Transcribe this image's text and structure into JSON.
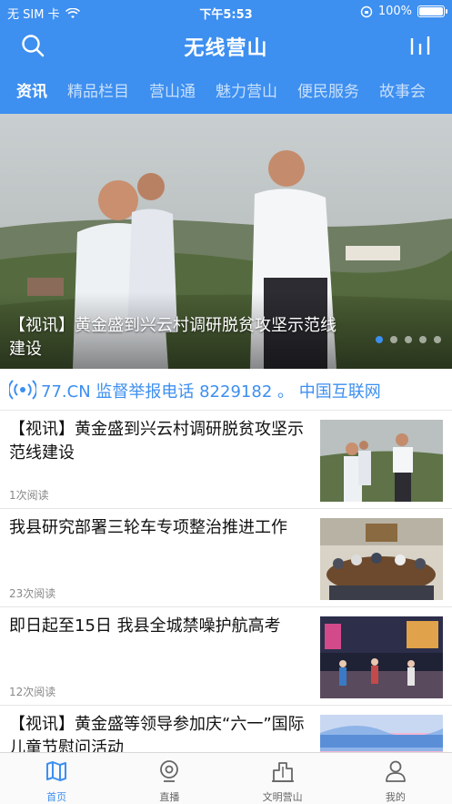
{
  "status_bar": {
    "carrier": "无 SIM 卡",
    "time": "下午5:53",
    "battery": "100%"
  },
  "header": {
    "title": "无线营山",
    "tabs": [
      {
        "label": "资讯",
        "active": true
      },
      {
        "label": "精品栏目",
        "active": false
      },
      {
        "label": "营山通",
        "active": false
      },
      {
        "label": "魅力营山",
        "active": false
      },
      {
        "label": "便民服务",
        "active": false
      },
      {
        "label": "故事会",
        "active": false
      }
    ]
  },
  "banner": {
    "caption": "【视讯】黄金盛到兴云村调研脱贫攻坚示范线建设",
    "dot_count": 5,
    "active_dot": 0
  },
  "ticker": {
    "text": "77.CN   监督举报电话 8229182 。  中国互联网"
  },
  "feed": [
    {
      "title": "【视讯】黄金盛到兴云村调研脱贫攻坚示范线建设",
      "reads": "1次阅读",
      "thumb": "thumb-officials-field"
    },
    {
      "title": "我县研究部署三轮车专项整治推进工作",
      "reads": "23次阅读",
      "thumb": "thumb-meeting-room"
    },
    {
      "title": "即日起至15日  我县全城禁噪护航高考",
      "reads": "12次阅读",
      "thumb": "thumb-night-street"
    },
    {
      "title": "【视讯】黄金盛等领导参加庆“六一”国际儿童节慰问活动",
      "reads": "",
      "thumb": "thumb-children-day"
    }
  ],
  "tabbar": [
    {
      "label": "首页",
      "icon": "map-icon",
      "active": true
    },
    {
      "label": "直播",
      "icon": "live-icon",
      "active": false
    },
    {
      "label": "文明营山",
      "icon": "building-icon",
      "active": false
    },
    {
      "label": "我的",
      "icon": "user-icon",
      "active": false
    }
  ],
  "colors": {
    "brand": "#3d8ff0",
    "divider": "#e6e6e6"
  }
}
